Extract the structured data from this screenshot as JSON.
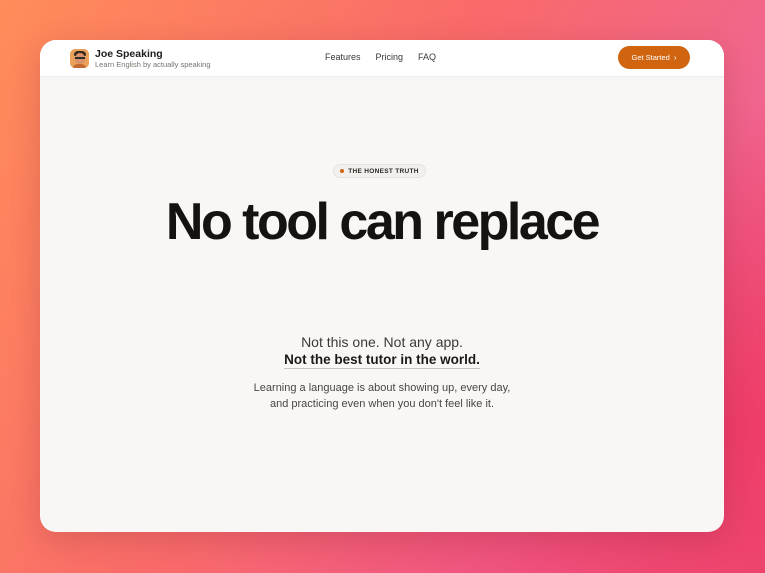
{
  "brand": {
    "name": "Joe Speaking",
    "tagline": "Learn English by actually speaking"
  },
  "nav": {
    "links": [
      "Features",
      "Pricing",
      "FAQ"
    ],
    "cta_label": "Get Started",
    "cta_icon": "chevron-right-icon"
  },
  "hero": {
    "eyebrow": "THE HONEST TRUTH",
    "headline": "No tool can replace",
    "sub_line_1": "Not this one. Not any app.",
    "sub_line_2": "Not the best tutor in the world.",
    "body_line_1": "Learning a language is about showing up, every day,",
    "body_line_2": "and practicing even when you don't feel like it."
  },
  "colors": {
    "accent": "#d0640f",
    "page_background": "#f8f7f5",
    "text_primary": "#141312"
  }
}
